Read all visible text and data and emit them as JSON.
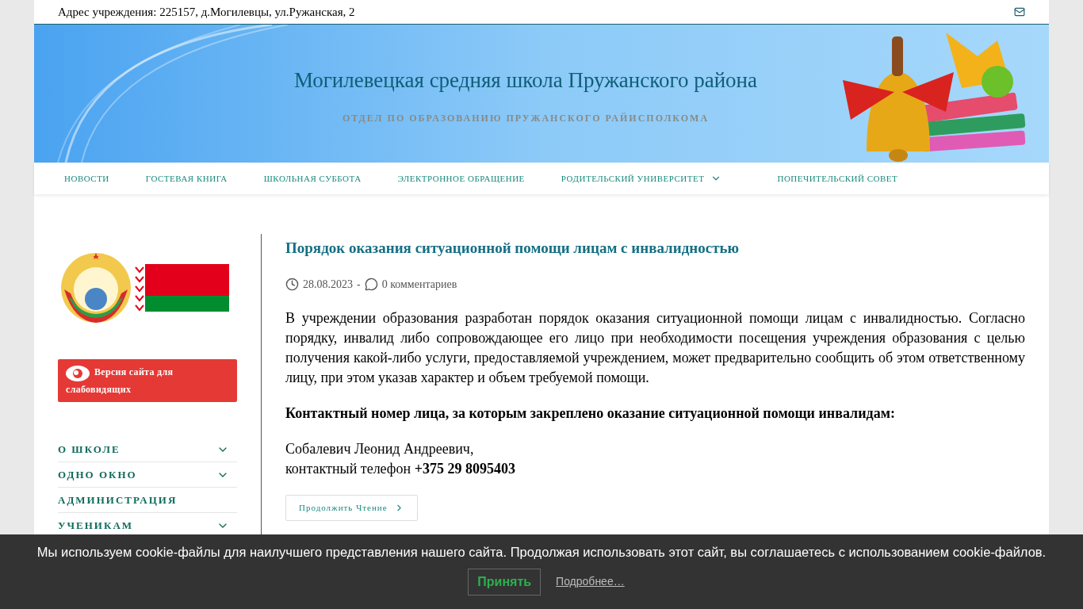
{
  "top_bar": {
    "address": "Адрес учреждения: 225157, д.Могилевцы, ул.Ружанская, 2"
  },
  "header": {
    "title": "Могилевецкая средняя школа Пружанского района",
    "subtitle": "ОТДЕЛ ПО ОБРАЗОВАНИЮ ПРУЖАНСКОГО РАЙИСПОЛКОМА"
  },
  "nav": [
    {
      "label": "НОВОСТИ",
      "dropdown": false
    },
    {
      "label": "ГОСТЕВАЯ КНИГА",
      "dropdown": false
    },
    {
      "label": "ШКОЛЬНАЯ СУББОТА",
      "dropdown": false
    },
    {
      "label": "ЭЛЕКТРОННОЕ ОБРАЩЕНИЕ",
      "dropdown": false
    },
    {
      "label": "РОДИТЕЛЬСКИЙ УНИВЕРСИТЕТ",
      "dropdown": true
    },
    {
      "label": "ПОПЕЧИТЕЛЬСКИЙ СОВЕТ",
      "dropdown": false
    }
  ],
  "sidebar": {
    "accessibility_button": "Версия сайта для слабовидящих",
    "menu": [
      {
        "label": "О ШКОЛЕ",
        "expandable": true
      },
      {
        "label": "ОДНО ОКНО",
        "expandable": true
      },
      {
        "label": "АДМИНИСТРАЦИЯ",
        "expandable": false
      },
      {
        "label": "УЧЕНИКАМ",
        "expandable": true
      }
    ]
  },
  "posts": [
    {
      "title": "Порядок оказания ситуационной помощи лицам с инвалидностью",
      "date": "28.08.2023",
      "separator": "-",
      "comments": "0 комментариев",
      "paragraphs": [
        {
          "kind": "text",
          "text": "В учреждении образования разработан порядок оказания ситуационной помощи лицам с инвалидностью. Согласно порядку, инвалид либо сопровождающее его лицо при необходимости посещения учреждения образования с целью получения какой-либо услуги, предоставляемой учреждением, может предварительно сообщить об этом ответственному лицу, при этом указав характер и объем требуемой помощи."
        },
        {
          "kind": "heading",
          "text": "Контактный номер лица, за которым закреплено оказание ситуационной помощи инвалидам:"
        },
        {
          "kind": "lines",
          "lines": [
            "Собалевич Леонид Андреевич,",
            "контактный телефон **+375 29 8095403**"
          ]
        }
      ],
      "read_more": "Продолжить Чтение"
    }
  ],
  "cookie": {
    "message": "Мы используем cookie-файлы для наилучшего представления нашего сайта. Продолжая использовать этот сайт, вы соглашаетесь с использованием cookie-файлов.",
    "accept": "Принять",
    "more": "Подробнее…"
  }
}
